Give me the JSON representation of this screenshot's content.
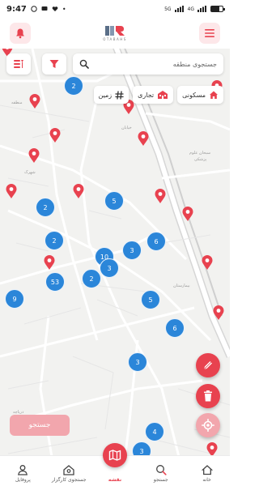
{
  "status_bar": {
    "time": "9:47",
    "network_label": "4G",
    "signal_text": "5G"
  },
  "header": {
    "logo_text": "OTABAHS"
  },
  "search": {
    "placeholder": "جستجوی منطقه"
  },
  "chips": [
    {
      "label": "مسکونی",
      "icon": "home-icon"
    },
    {
      "label": "تجاری",
      "icon": "building-icon"
    },
    {
      "label": "زمین",
      "icon": "hash-icon"
    }
  ],
  "clusters": [
    {
      "id": "c1",
      "count": "2"
    },
    {
      "id": "c2",
      "count": "5"
    },
    {
      "id": "c3",
      "count": "2"
    },
    {
      "id": "c4",
      "count": "2"
    },
    {
      "id": "c5",
      "count": "6"
    },
    {
      "id": "c6",
      "count": "3"
    },
    {
      "id": "c7",
      "count": "10"
    },
    {
      "id": "c8",
      "count": "3"
    },
    {
      "id": "c9",
      "count": "53"
    },
    {
      "id": "c10",
      "count": "2"
    },
    {
      "id": "c11",
      "count": "9"
    },
    {
      "id": "c12",
      "count": "5"
    },
    {
      "id": "c13",
      "count": "6"
    },
    {
      "id": "c14",
      "count": "3"
    },
    {
      "id": "c15",
      "count": "4"
    },
    {
      "id": "c16",
      "count": "3"
    }
  ],
  "map_labels": [
    "منطقه",
    "خیابان",
    "شهرک",
    "سبحان علوم",
    "پزشکی",
    "بیمارستان",
    "دریاچه"
  ],
  "search_button": {
    "label": "جستجو"
  },
  "bottom_nav": [
    {
      "label": "پروفایل",
      "icon": "user-icon",
      "active": false
    },
    {
      "label": "جستجوی کارگزار",
      "icon": "agent-search-icon",
      "active": false
    },
    {
      "label": "نقشه",
      "icon": "map-icon",
      "active": true
    },
    {
      "label": "جستجو",
      "icon": "search-icon",
      "active": false
    },
    {
      "label": "خانه",
      "icon": "home-icon",
      "active": false
    }
  ],
  "colors": {
    "accent": "#e8424f",
    "cluster": "#2b86d9",
    "accent_light": "#fde7e9"
  }
}
